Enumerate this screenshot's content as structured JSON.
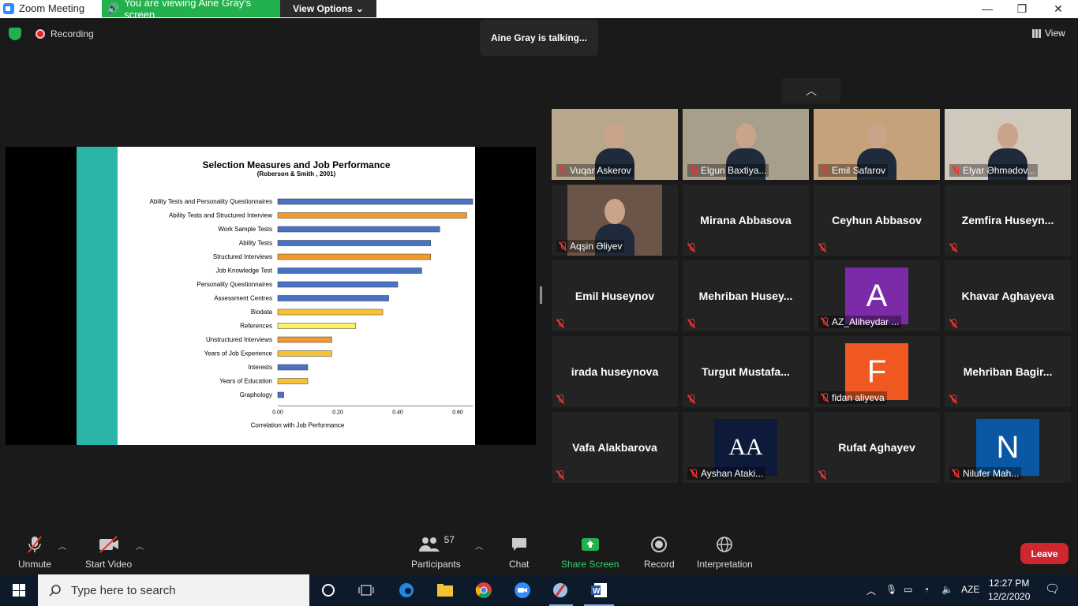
{
  "window": {
    "title": "Zoom Meeting",
    "viewing_text": "You are viewing Aine Gray's screen",
    "view_options": "View Options",
    "minimize": "—",
    "restore": "❐",
    "close": "✕"
  },
  "top": {
    "recording": "Recording",
    "talking": "Aine Gray is talking...",
    "view": "View"
  },
  "chart_data": {
    "type": "bar",
    "title": "Selection Measures and Job Performance",
    "subtitle": "(Roberson & Smith , 2001)",
    "xlabel": "Correlation  with Job Performance",
    "xlim": [
      0,
      0.65
    ],
    "xticks": [
      "0.00",
      "0.20",
      "0.40",
      "0.60"
    ],
    "categories": [
      "Ability Tests and Personality Questionnaires",
      "Ability Tests and Structured Interview",
      "Work Sample Tests",
      "Ability Tests",
      "Structured Interviews",
      "Job Knowledge Test",
      "Personality Questionnaires",
      "Assessment Centres",
      "Biodata",
      "References",
      "Unstructured Interviews",
      "Years of Job Experience",
      "Interests",
      "Years of Education",
      "Graphology"
    ],
    "values": [
      0.65,
      0.63,
      0.54,
      0.51,
      0.51,
      0.48,
      0.4,
      0.37,
      0.35,
      0.26,
      0.18,
      0.18,
      0.1,
      0.1,
      0.02
    ],
    "colors": [
      "#4a72c4",
      "#f39a2c",
      "#4a72c4",
      "#4a72c4",
      "#f39a2c",
      "#4a72c4",
      "#4a72c4",
      "#4a72c4",
      "#f6c233",
      "#fbf26a",
      "#f39a2c",
      "#f6c233",
      "#4a72c4",
      "#f6c233",
      "#4a72c4"
    ]
  },
  "gallery": {
    "up_arrow": "︿",
    "participants": [
      {
        "name": "Vuqar Askerov",
        "kind": "video",
        "bg": "#b9a78c"
      },
      {
        "name": "Elgun Baxtiya...",
        "kind": "video",
        "bg": "#a89e8c"
      },
      {
        "name": "Emil Safarov",
        "kind": "video",
        "bg": "#c6a27a"
      },
      {
        "name": "Elyar Əhmədov...",
        "kind": "video",
        "bg": "#cfc8bb"
      },
      {
        "name": "Aqşin Əliyev",
        "kind": "video",
        "bg": "#6b5548"
      },
      {
        "name": "Mirana Abbasova",
        "kind": "name"
      },
      {
        "name": "Ceyhun Abbasov",
        "kind": "name"
      },
      {
        "name": "Zemfira  Huseyn...",
        "kind": "name"
      },
      {
        "name": "Emil Huseynov",
        "kind": "name"
      },
      {
        "name": "Mehriban  Husey...",
        "kind": "name"
      },
      {
        "name": "AZ_Aliheydar ...",
        "kind": "avatar",
        "letter": "A",
        "bg": "#7b2aa8"
      },
      {
        "name": "Khavar Aghayeva",
        "kind": "name"
      },
      {
        "name": "irada huseynova",
        "kind": "name"
      },
      {
        "name": "Turgut  Mustafa...",
        "kind": "name"
      },
      {
        "name": "fidan aliyeva",
        "kind": "avatar",
        "letter": "F",
        "bg": "#f05a22"
      },
      {
        "name": "Mehriban  Bagir...",
        "kind": "name"
      },
      {
        "name": "Vafa Alakbarova",
        "kind": "name"
      },
      {
        "name": "Ayshan Ataki...",
        "kind": "avatar",
        "letter": "AA",
        "bg": "#0e1a3a"
      },
      {
        "name": "Rufat Aghayev",
        "kind": "name"
      },
      {
        "name": "Nilufer Mah...",
        "kind": "avatar",
        "letter": "N",
        "bg": "#0a57a4"
      }
    ]
  },
  "toolbar": {
    "unmute": "Unmute",
    "start_video": "Start Video",
    "participants": "Participants",
    "participants_count": "57",
    "chat": "Chat",
    "share_screen": "Share Screen",
    "record": "Record",
    "interpretation": "Interpretation",
    "leave": "Leave"
  },
  "taskbar": {
    "search_placeholder": "Type here to search",
    "lang": "AZE",
    "time": "12:27 PM",
    "date": "12/2/2020"
  }
}
